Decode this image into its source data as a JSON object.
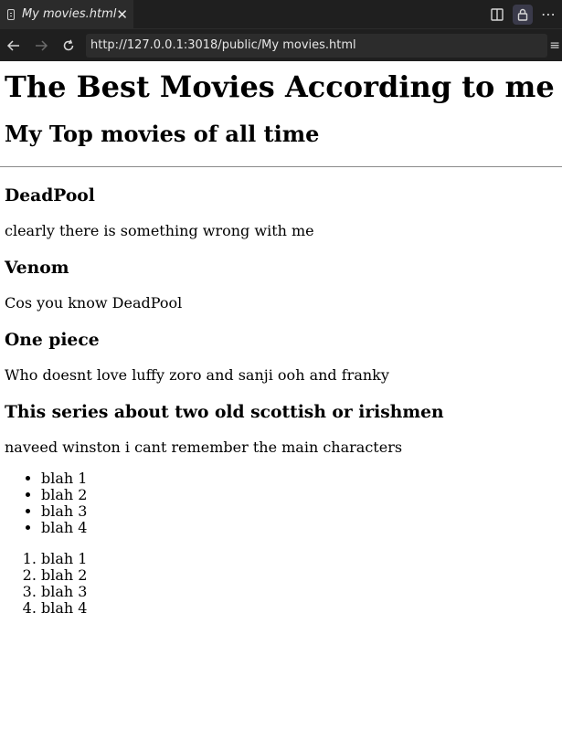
{
  "browser": {
    "tab_title": "My movies.html",
    "url": "http://127.0.0.1:3018/public/My movies.html"
  },
  "page": {
    "h1": "The Best Movies According to me",
    "h2": "My Top movies of all time",
    "movies": [
      {
        "title": "DeadPool",
        "desc": "clearly there is something wrong with me"
      },
      {
        "title": "Venom",
        "desc": "Cos you know DeadPool"
      },
      {
        "title": "One piece",
        "desc": "Who doesnt love luffy zoro and sanji ooh and franky"
      },
      {
        "title": "This series about two old scottish or irishmen",
        "desc": "naveed winston i cant remember the main characters"
      }
    ],
    "ul_items": [
      "blah 1",
      "blah 2",
      "blah 3",
      "blah 4"
    ],
    "ol_items": [
      "blah 1",
      "blah 2",
      "blah 3",
      "blah 4"
    ]
  }
}
